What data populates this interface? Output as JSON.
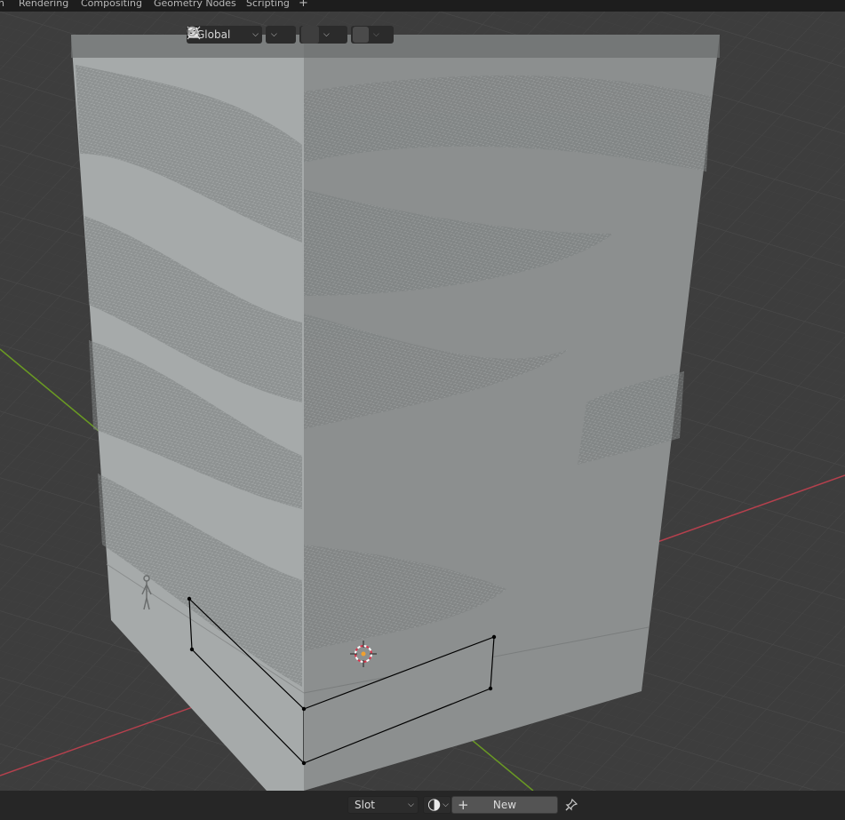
{
  "workspace_tabs": [
    {
      "label": "n"
    },
    {
      "label": "Rendering"
    },
    {
      "label": "Compositing"
    },
    {
      "label": "Geometry Nodes"
    },
    {
      "label": "Scripting"
    }
  ],
  "add_workspace_label": "+",
  "header": {
    "transform_orientation": "Global",
    "pivot_icon": "pivot-icon",
    "snap_icon": "snap-magnet-icon",
    "snap_target_icon": "snap-increment-icon",
    "proportional_icon": "proportional-edit-icon",
    "falloff_icon": "falloff-curve-icon"
  },
  "bottom_bar": {
    "slot_label": "Slot",
    "new_label": "New",
    "add_icon_label": "+",
    "material_icon": "material-browse-icon",
    "pin_icon": "pin-icon"
  },
  "colors": {
    "viewport_bg": "#3d3d3d",
    "grid": "#4a4a4a",
    "x_axis": "#b5404d",
    "y_axis": "#6a9a23",
    "face_left": "#a6aaaa",
    "face_right": "#8c8f8f",
    "edge_selected": "#000000"
  }
}
